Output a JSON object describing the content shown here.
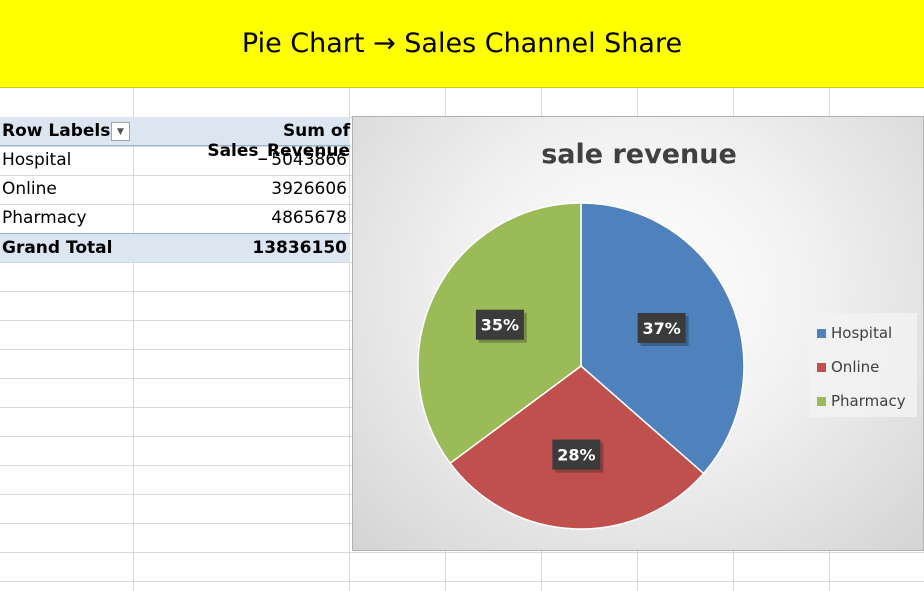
{
  "banner": {
    "title": "Pie Chart → Sales Channel Share"
  },
  "pivot": {
    "header_label": "Row Labels",
    "header_value": "Sum of Sales_Revenue",
    "rows": [
      {
        "label": "Hospital",
        "value": "5043866"
      },
      {
        "label": "Online",
        "value": "3926606"
      },
      {
        "label": "Pharmacy",
        "value": "4865678"
      }
    ],
    "total_label": "Grand Total",
    "total_value": "13836150"
  },
  "chart_data": {
    "type": "pie",
    "title": "sale revenue",
    "categories": [
      "Hospital",
      "Online",
      "Pharmacy"
    ],
    "values": [
      5043866,
      3926606,
      4865678
    ],
    "labels": [
      "37%",
      "28%",
      "35%"
    ],
    "colors": [
      "#4f81bd",
      "#c0504d",
      "#9bbb59"
    ],
    "legend": "right"
  }
}
